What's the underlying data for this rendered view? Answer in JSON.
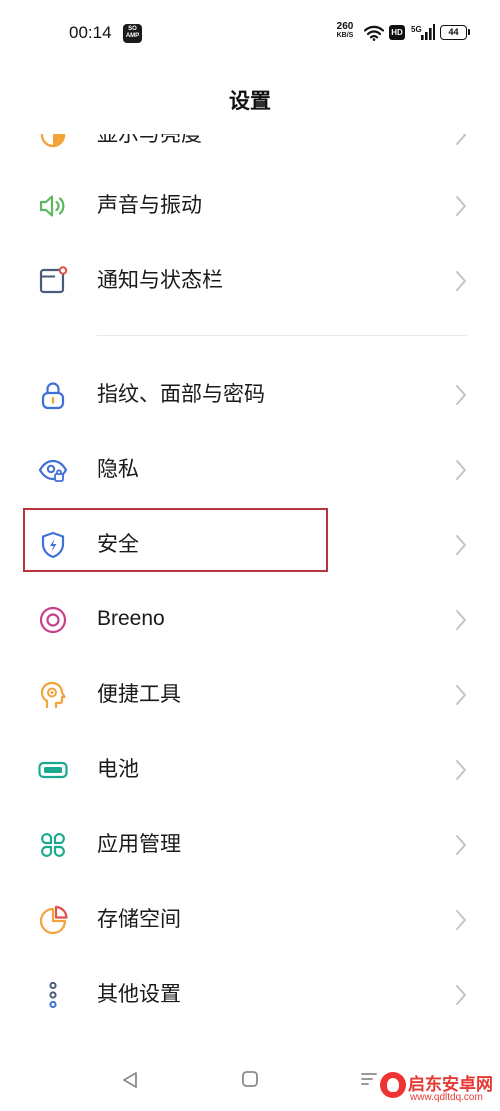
{
  "status_bar": {
    "time": "00:14",
    "app_badge": "SO\nAMP",
    "net_speed_value": "260",
    "net_speed_unit": "KB/S",
    "hd": "HD",
    "network": "5G",
    "battery": "44"
  },
  "header": {
    "title": "设置"
  },
  "settings": {
    "items": [
      {
        "label": "显示与亮度",
        "icon": "display-brightness-icon",
        "color": "#f2a33a"
      },
      {
        "label": "声音与振动",
        "icon": "speaker-icon",
        "color": "#5cb85c"
      },
      {
        "label": "通知与状态栏",
        "icon": "notification-icon",
        "color": "#4a5a7a"
      },
      {
        "label": "指纹、面部与密码",
        "icon": "lock-icon",
        "color": "#3f6fd8"
      },
      {
        "label": "隐私",
        "icon": "privacy-eye-icon",
        "color": "#3f6fd8"
      },
      {
        "label": "安全",
        "icon": "security-shield-icon",
        "color": "#3f6fd8"
      },
      {
        "label": "Breeno",
        "icon": "breeno-icon",
        "color": "#c8408a"
      },
      {
        "label": "便捷工具",
        "icon": "tools-icon",
        "color": "#f2a33a"
      },
      {
        "label": "电池",
        "icon": "battery-icon",
        "color": "#1ba98e"
      },
      {
        "label": "应用管理",
        "icon": "apps-icon",
        "color": "#1ba98e"
      },
      {
        "label": "存储空间",
        "icon": "storage-icon",
        "color": "#f2a33a"
      },
      {
        "label": "其他设置",
        "icon": "more-settings-icon",
        "color": "#4a5a7a"
      }
    ]
  },
  "watermark": {
    "title": "启东安卓网",
    "url": "www.qdltdq.com"
  },
  "colors": {
    "highlight": "#b8343c",
    "chevron": "#c4c4c4",
    "divider": "#e9e9e9"
  }
}
